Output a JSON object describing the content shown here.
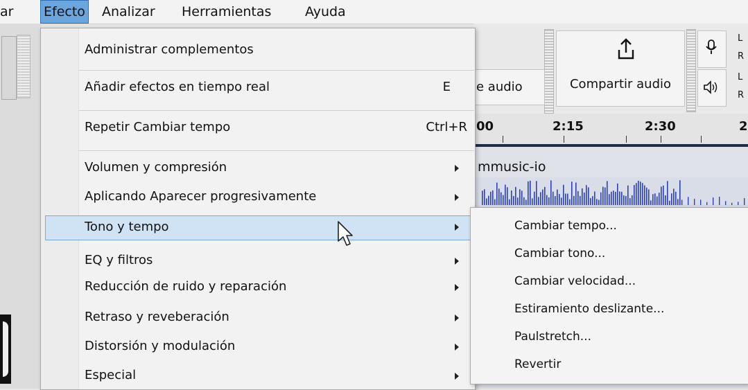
{
  "menubar": {
    "items": [
      {
        "label": "ar"
      },
      {
        "label": "Efecto"
      },
      {
        "label": "Analizar"
      },
      {
        "label": "Herramientas"
      },
      {
        "label": "Ayuda"
      }
    ]
  },
  "toolbar": {
    "audio_fragment": "e audio",
    "share_audio": "Compartir audio",
    "rec_lr": [
      "L",
      "R"
    ],
    "play_lr": [
      "L",
      "R"
    ]
  },
  "ruler": {
    "labels": [
      "00",
      "2:15",
      "2:30",
      "2:"
    ]
  },
  "track": {
    "name": "mmusic-io"
  },
  "efecto_menu": {
    "items": [
      {
        "label": "Administrar complementos",
        "shortcut": ""
      },
      {
        "label": "Añadir efectos en tiempo real",
        "shortcut": "E"
      },
      {
        "label": "Repetir Cambiar tempo",
        "shortcut": "Ctrl+R"
      },
      {
        "label": "Volumen y compresión",
        "submenu": true
      },
      {
        "label": "Aplicando Aparecer progresivamente",
        "submenu": true
      },
      {
        "label": "Tono y tempo",
        "submenu": true,
        "highlighted": true
      },
      {
        "label": "EQ y filtros",
        "submenu": true
      },
      {
        "label": "Reducción de ruido y reparación",
        "submenu": true
      },
      {
        "label": "Retraso y reveberación",
        "submenu": true
      },
      {
        "label": "Distorsión y modulación",
        "submenu": true
      },
      {
        "label": "Especial",
        "submenu": true
      }
    ]
  },
  "tono_submenu": {
    "items": [
      {
        "label": "Cambiar tempo..."
      },
      {
        "label": "Cambiar tono..."
      },
      {
        "label": "Cambiar velocidad..."
      },
      {
        "label": "Estiramiento deslizante..."
      },
      {
        "label": "Paulstretch..."
      },
      {
        "label": "Revertir"
      }
    ]
  },
  "colors": {
    "menubar_active": "#6aa5dd",
    "menu_highlight": "#cfe3f5",
    "waveform": "#2a3fb8"
  }
}
